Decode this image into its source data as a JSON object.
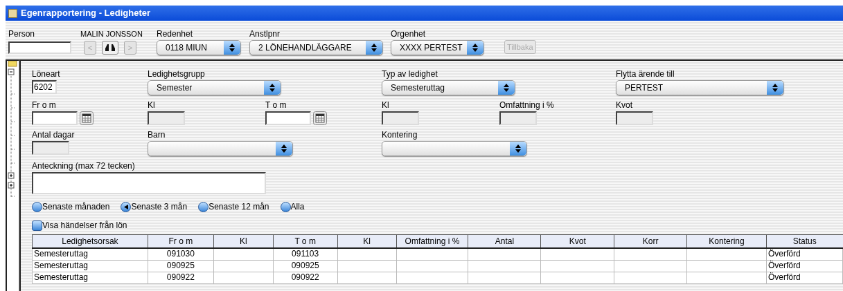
{
  "window": {
    "title": "Egenrapportering - Ledigheter"
  },
  "toolbar": {
    "person": {
      "label": "Person"
    },
    "name": "MALIN JONSSON",
    "prev_button": {
      "label": "<",
      "disabled": true
    },
    "next_button": {
      "label": ">",
      "disabled": true
    },
    "selects": [
      {
        "label": "Redenhet",
        "value": "0118  MIUN"
      },
      {
        "label": "Anstlpnr",
        "value": "2  LÖNEHANDLÄGGARE"
      },
      {
        "label": "Orgenhet",
        "value": "XXXX  PERTEST"
      }
    ],
    "back_button": {
      "label": "Tillbaka",
      "disabled": true
    }
  },
  "form": [
    [
      {
        "kind": "text",
        "label": "Löneart",
        "value": "6202",
        "disabled": false
      },
      {
        "kind": "select",
        "label": "Ledighetsgrupp",
        "value": "Semester"
      },
      {
        "kind": "select",
        "label": "Typ av ledighet",
        "value": "Semesteruttag"
      },
      {
        "kind": "select",
        "label": "Flytta ärende till",
        "value": "PERTEST"
      }
    ],
    [
      {
        "kind": "date",
        "label": "Fr o m",
        "disabled": false
      },
      {
        "kind": "text",
        "label": "Kl",
        "disabled": true
      },
      {
        "kind": "date",
        "label": "T o m",
        "disabled": false
      },
      {
        "kind": "text",
        "label": "Kl",
        "disabled": true
      },
      {
        "kind": "text",
        "label": "Omfattning i %",
        "disabled": true
      },
      {
        "kind": "text",
        "label": "Kvot",
        "disabled": true
      }
    ],
    [
      {
        "kind": "text",
        "label": "Antal dagar",
        "disabled": true
      },
      {
        "kind": "select",
        "label": "Barn"
      },
      {
        "kind": "select",
        "label": "Kontering"
      }
    ],
    [
      {
        "kind": "textarea",
        "label": "Anteckning (max 72 tecken)"
      }
    ]
  ],
  "period": [
    {
      "label": "Senaste månaden",
      "selected": false
    },
    {
      "label": "Senaste 3 mån",
      "selected": true
    },
    {
      "label": "Senaste 12 mån",
      "selected": false
    },
    {
      "label": "Alla",
      "selected": false
    }
  ],
  "show_payroll_events": {
    "label": "Visa händelser från lön",
    "checked": false
  },
  "table": {
    "columns": [
      "Ledighetsorsak",
      "Fr o m",
      "Kl",
      "T o m",
      "Kl",
      "Omfattning i %",
      "Antal",
      "Kvot",
      "Korr",
      "Kontering",
      "Status"
    ],
    "rows": [
      [
        "Semesteruttag",
        "091030",
        null,
        "091103",
        null,
        null,
        null,
        null,
        null,
        null,
        "Överförd"
      ],
      [
        "Semesteruttag",
        "090925",
        null,
        "090925",
        null,
        null,
        null,
        null,
        null,
        null,
        "Överförd"
      ],
      [
        "Semesteruttag",
        "090922",
        null,
        "090922",
        null,
        null,
        null,
        null,
        null,
        null,
        "Överförd"
      ]
    ]
  }
}
